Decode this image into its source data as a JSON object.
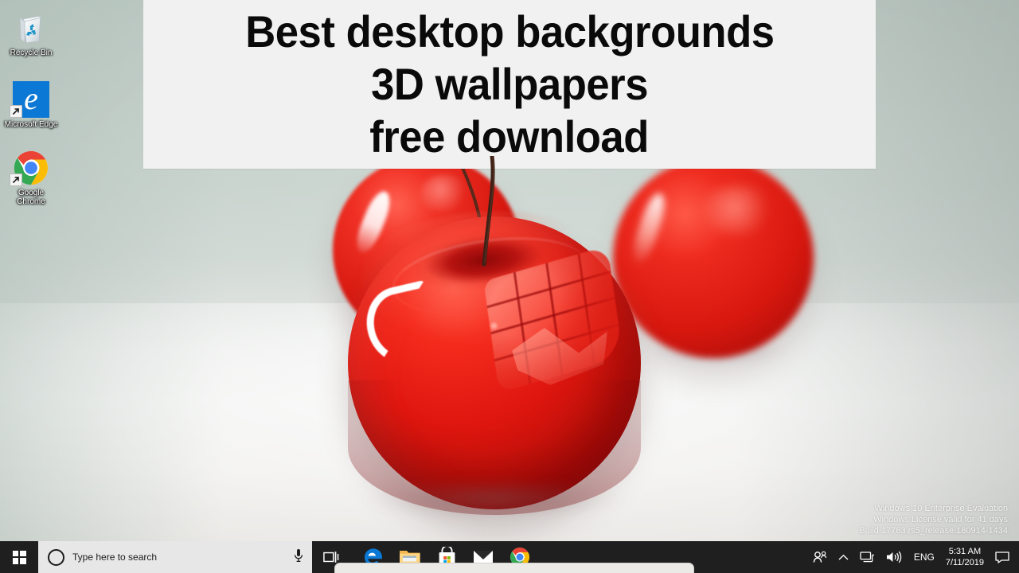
{
  "desktop": {
    "icons": [
      {
        "name": "recycle-bin",
        "label": "Recycle Bin"
      },
      {
        "name": "microsoft-edge",
        "label": "Microsoft Edge"
      },
      {
        "name": "google-chrome",
        "label": "Google Chrome"
      }
    ],
    "wallpaper_description": "Three glossy red 3D cherries on a light gray-green gradient surface"
  },
  "banner": {
    "line1": "Best desktop backgrounds",
    "line2": "3D wallpapers",
    "line3": "free download",
    "background_color": "#f1f1f1",
    "text_color": "#0a0a0a"
  },
  "watermark": {
    "line1": "Windows 10 Enterprise Evaluation",
    "line2": "Windows License valid for 41 days",
    "line3": "Build 17763.rs5_release.180914-1434"
  },
  "taskbar": {
    "background_color": "#1f1f1f",
    "start_label": "Start",
    "search": {
      "placeholder": "Type here to search",
      "cortana_icon": "cortana-circle-icon",
      "mic_icon": "microphone-icon",
      "background_color": "#e7e7e7"
    },
    "task_view_label": "Task View",
    "apps": [
      {
        "name": "microsoft-edge",
        "label": "Microsoft Edge"
      },
      {
        "name": "file-explorer",
        "label": "File Explorer"
      },
      {
        "name": "microsoft-store",
        "label": "Microsoft Store"
      },
      {
        "name": "mail",
        "label": "Mail"
      },
      {
        "name": "google-chrome",
        "label": "Google Chrome"
      }
    ],
    "tray": {
      "people_label": "People",
      "show_hidden_label": "Show hidden icons",
      "network_label": "Network",
      "volume_label": "Speakers",
      "language": "ENG",
      "time": "5:31 AM",
      "date": "7/11/2019",
      "action_center_label": "Action Center"
    }
  }
}
